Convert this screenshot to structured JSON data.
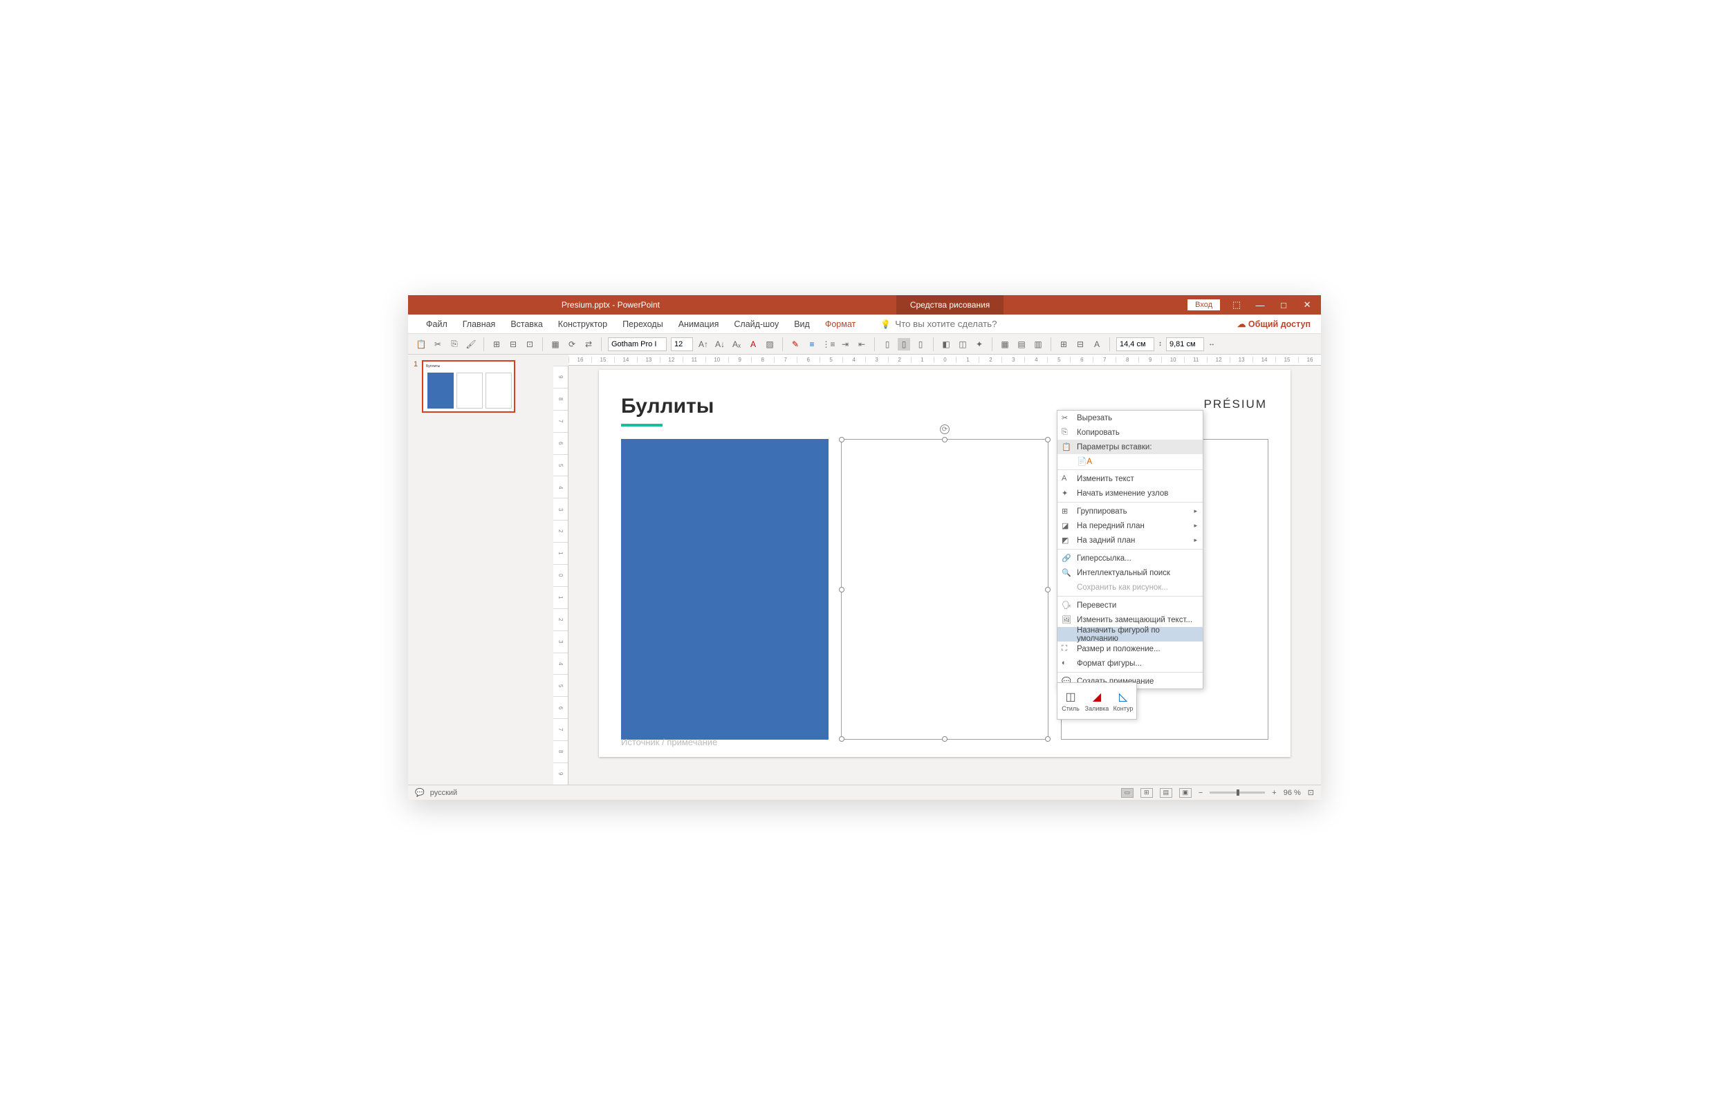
{
  "titlebar": {
    "filename": "Presium.pptx  -  PowerPoint",
    "tools_tab": "Средства рисования",
    "signin": "Вход"
  },
  "menu": {
    "tabs": [
      "Файл",
      "Главная",
      "Вставка",
      "Конструктор",
      "Переходы",
      "Анимация",
      "Слайд-шоу",
      "Вид",
      "Формат"
    ],
    "active_tab": "Формат",
    "tellme_placeholder": "Что вы хотите сделать?",
    "share": "Общий доступ"
  },
  "toolbar": {
    "font": "Gotham Pro I",
    "font_size": "12",
    "height": "14,4 см",
    "width": "9,81 см"
  },
  "ruler_h": [
    "16",
    "15",
    "14",
    "13",
    "12",
    "11",
    "10",
    "9",
    "8",
    "7",
    "6",
    "5",
    "4",
    "3",
    "2",
    "1",
    "0",
    "1",
    "2",
    "3",
    "4",
    "5",
    "6",
    "7",
    "8",
    "9",
    "10",
    "11",
    "12",
    "13",
    "14",
    "15",
    "16"
  ],
  "ruler_v": [
    "9",
    "8",
    "7",
    "6",
    "5",
    "4",
    "3",
    "2",
    "1",
    "0",
    "1",
    "2",
    "3",
    "4",
    "5",
    "6",
    "7",
    "8",
    "9"
  ],
  "thumbnail": {
    "number": "1",
    "title": "Буллиты"
  },
  "slide": {
    "title": "Буллиты",
    "logo": "PRÉSIUM",
    "footer": "Источник / примечание"
  },
  "context_menu": {
    "cut": "Вырезать",
    "copy": "Копировать",
    "paste_options": "Параметры вставки:",
    "edit_text": "Изменить текст",
    "edit_points": "Начать изменение узлов",
    "group": "Группировать",
    "bring_front": "На передний план",
    "send_back": "На задний план",
    "hyperlink": "Гиперссылка...",
    "smart_lookup": "Интеллектуальный поиск",
    "save_as_pic": "Сохранить как рисунок...",
    "translate": "Перевести",
    "alt_text": "Изменить замещающий текст...",
    "set_default": "Назначить фигурой по умолчанию",
    "size_position": "Размер и положение...",
    "format_shape": "Формат фигуры...",
    "new_comment": "Создать примечание"
  },
  "mini_toolbar": {
    "style": "Стиль",
    "fill": "Заливка",
    "outline": "Контур"
  },
  "statusbar": {
    "lang": "русский",
    "zoom": "96 %"
  }
}
